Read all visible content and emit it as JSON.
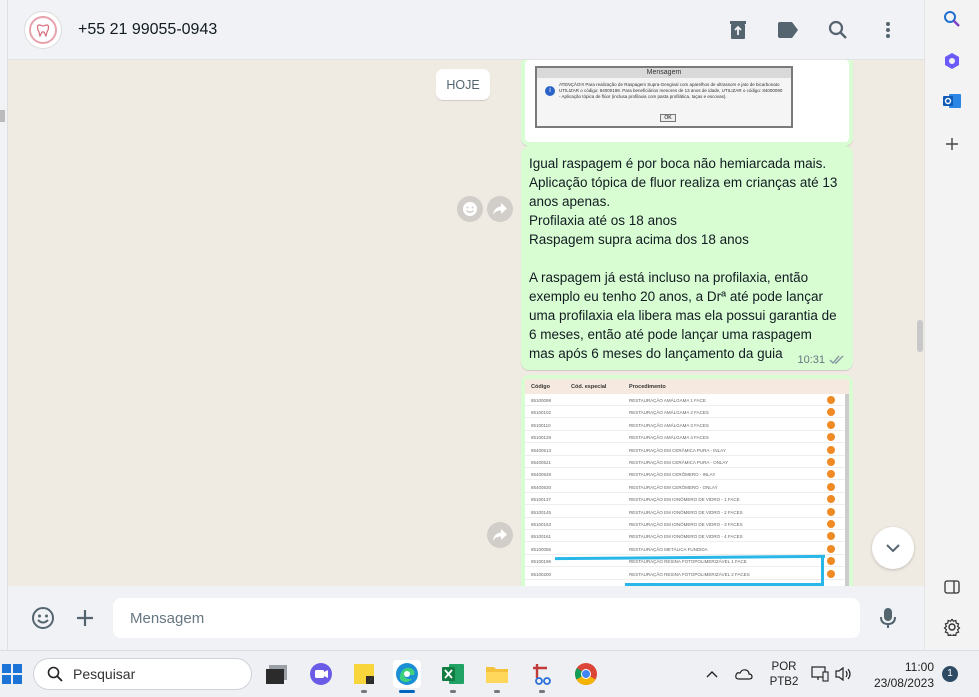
{
  "header": {
    "contact_name": "+55 21 99055-0943"
  },
  "chat": {
    "date_chip": "HOJE",
    "message": {
      "lines": [
        "Igual raspagem é por boca não hemiarcada mais.",
        "Aplicação tópica de fluor realiza em crianças até 13",
        "anos apenas.",
        "Profilaxia até os 18 anos",
        "Raspagem supra acima dos 18 anos",
        "",
        "A raspagem já está incluso na profilaxia, então",
        "exemplo eu tenho 20 anos, a Drª até pode lançar",
        "uma profilaxia ela libera mas ela possui garantia de",
        "6 meses, então até pode lançar uma raspagem",
        "mas após 6 meses do lançamento da guia"
      ],
      "time": "10:31"
    },
    "image1": {
      "dialog_title": "Mensagem",
      "dialog_text": "ATENÇÃO!!! Para realização de Raspagem Supra-Gengival com aparelhos de ultrassom e jato de bicarbonato UTILIZAR o código: 84000198. Para beneficiários menores de 13 anos de idade, UTILIZAR o código: 84000090 - Aplicação tópica de flúor (inclusa profilaxia com pasta profilática, taças e escovas).",
      "dialog_ok": "OK"
    },
    "image2": {
      "headers": [
        "Código",
        "Cód. especial",
        "Procedimento"
      ],
      "rows": [
        [
          "85100099",
          "RESTAURAÇÃO AMÁLGAMA 1 FACE"
        ],
        [
          "85100102",
          "RESTAURAÇÃO AMÁLGAMA 2 FACES"
        ],
        [
          "85100110",
          "RESTAURAÇÃO AMÁLGAMA 3 FACES"
        ],
        [
          "85100129",
          "RESTAURAÇÃO AMÁLGAMA 4 FACES"
        ],
        [
          "85400513",
          "RESTAURAÇÃO EM CERÂMICA PURA - INLAY"
        ],
        [
          "85400521",
          "RESTAURAÇÃO EM CERÂMICA PURA - ONLAY"
        ],
        [
          "85400548",
          "RESTAURAÇÃO EM CERÔMERO - INLAY"
        ],
        [
          "85400530",
          "RESTAURAÇÃO EM CERÔMERO - ONLAY"
        ],
        [
          "85100137",
          "RESTAURAÇÃO EM IONÔMERO DE VIDRO - 1 FACE"
        ],
        [
          "85100145",
          "RESTAURAÇÃO EM IONÔMERO DE VIDRO - 2 FACES"
        ],
        [
          "85100153",
          "RESTAURAÇÃO EM IONÔMERO DE VIDRO - 3 FACES"
        ],
        [
          "85100161",
          "RESTAURAÇÃO EM IONÔMERO DE VIDRO - 4 FACES"
        ],
        [
          "85100056",
          "RESTAURAÇÃO METÁLICA FUNDIDA"
        ],
        [
          "85100196",
          "RESTAURAÇÃO RESINA FOTOPOLIMERIZÁVEL 1 FACE"
        ],
        [
          "85100200",
          "RESTAURAÇÃO RESINA FOTOPOLIMERIZÁVEL 2 FACES"
        ]
      ]
    }
  },
  "composer": {
    "placeholder": "Mensagem"
  },
  "taskbar": {
    "search_label": "Pesquisar",
    "lang_line1": "POR",
    "lang_line2": "PTB2",
    "time": "11:00",
    "date": "23/08/2023",
    "notification_count": "1"
  },
  "colors": {
    "outgoing_bubble": "#d9fdd3",
    "chat_background": "#efeae2",
    "header_background": "#f0f2f5",
    "accent_blue": "#29b6e8",
    "read_ticks": "#8696a0"
  },
  "icons": {
    "header": [
      "archive-icon",
      "label-icon",
      "search-icon",
      "menu-icon"
    ],
    "sidebar": [
      "search-icon",
      "copilot-icon",
      "outlook-icon",
      "add-icon",
      "split-view-icon",
      "settings-icon"
    ],
    "taskbar": [
      "windows-start-icon",
      "task-view-icon",
      "teams-icon",
      "sticky-notes-icon",
      "edge-icon",
      "excel-icon",
      "file-explorer-icon",
      "snipping-tool-icon",
      "chrome-icon"
    ]
  }
}
